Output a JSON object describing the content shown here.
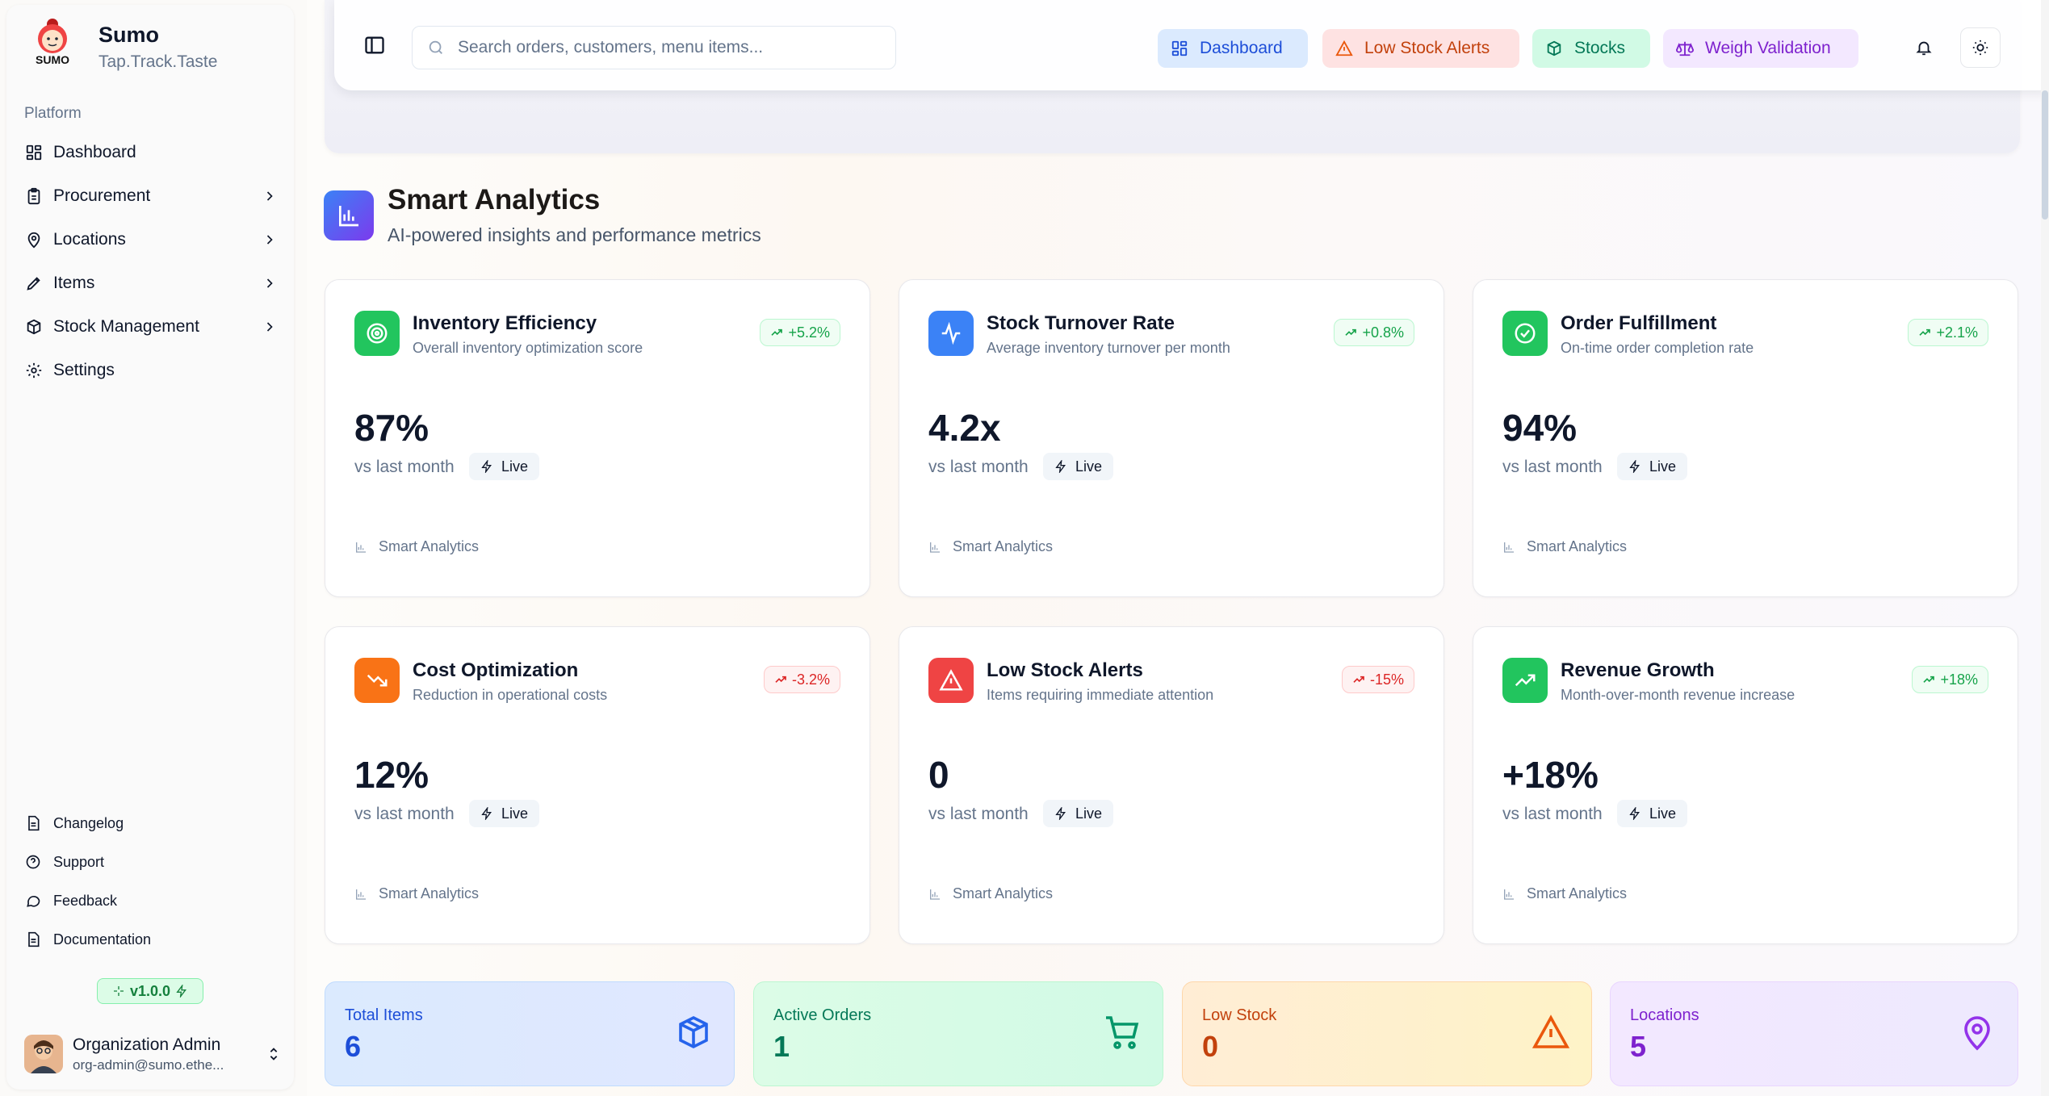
{
  "brand": {
    "title": "Sumo",
    "subtitle": "Tap.Track.Taste",
    "logo_text": "SUMO"
  },
  "sidebar": {
    "group_label": "Platform",
    "items": [
      {
        "label": "Dashboard",
        "icon": "layout-grid-icon",
        "has_submenu": false
      },
      {
        "label": "Procurement",
        "icon": "clipboard-icon",
        "has_submenu": true
      },
      {
        "label": "Locations",
        "icon": "map-pin-icon",
        "has_submenu": true
      },
      {
        "label": "Items",
        "icon": "pen-tool-icon",
        "has_submenu": true
      },
      {
        "label": "Stock Management",
        "icon": "boxes-icon",
        "has_submenu": true
      },
      {
        "label": "Settings",
        "icon": "gear-icon",
        "has_submenu": false
      }
    ],
    "footer_items": [
      {
        "label": "Changelog",
        "icon": "document-icon"
      },
      {
        "label": "Support",
        "icon": "help-circle-icon"
      },
      {
        "label": "Feedback",
        "icon": "message-circle-icon"
      },
      {
        "label": "Documentation",
        "icon": "document-icon"
      }
    ],
    "version": "v1.0.0",
    "user": {
      "name": "Organization Admin",
      "email": "org-admin@sumo.ethe..."
    }
  },
  "header": {
    "search_placeholder": "Search orders, customers, menu items...",
    "quick_links": [
      {
        "label": "Dashboard",
        "color": "#1d4ed8"
      },
      {
        "label": "Low Stock Alerts",
        "color": "#c2410c"
      },
      {
        "label": "Stocks",
        "color": "#047857"
      },
      {
        "label": "Weigh Validation",
        "color": "#7e22ce"
      }
    ]
  },
  "section": {
    "title": "Smart Analytics",
    "subtitle": "AI-powered insights and performance metrics"
  },
  "metrics": [
    {
      "title": "Inventory Efficiency",
      "description": "Overall inventory optimization score",
      "change": "+5.2%",
      "trend": "up",
      "value": "87%",
      "vs": "vs last month",
      "live": "Live",
      "footer": "Smart Analytics",
      "icon": "target-icon",
      "color": "#22c55e"
    },
    {
      "title": "Stock Turnover Rate",
      "description": "Average inventory turnover per month",
      "change": "+0.8%",
      "trend": "up",
      "value": "4.2x",
      "vs": "vs last month",
      "live": "Live",
      "footer": "Smart Analytics",
      "icon": "activity-icon",
      "color": "#3b82f6"
    },
    {
      "title": "Order Fulfillment",
      "description": "On-time order completion rate",
      "change": "+2.1%",
      "trend": "up",
      "value": "94%",
      "vs": "vs last month",
      "live": "Live",
      "footer": "Smart Analytics",
      "icon": "check-circle-icon",
      "color": "#22c55e"
    },
    {
      "title": "Cost Optimization",
      "description": "Reduction in operational costs",
      "change": "-3.2%",
      "trend": "down",
      "value": "12%",
      "vs": "vs last month",
      "live": "Live",
      "footer": "Smart Analytics",
      "icon": "trending-down-icon",
      "color": "#f97316"
    },
    {
      "title": "Low Stock Alerts",
      "description": "Items requiring immediate attention",
      "change": "-15%",
      "trend": "down",
      "value": "0",
      "vs": "vs last month",
      "live": "Live",
      "footer": "Smart Analytics",
      "icon": "alert-triangle-icon",
      "color": "#ef4444"
    },
    {
      "title": "Revenue Growth",
      "description": "Month-over-month revenue increase",
      "change": "+18%",
      "trend": "up",
      "value": "+18%",
      "vs": "vs last month",
      "live": "Live",
      "footer": "Smart Analytics",
      "icon": "trending-up-icon",
      "color": "#22c55e"
    }
  ],
  "stats": [
    {
      "label": "Total Items",
      "value": "6",
      "icon": "box-icon"
    },
    {
      "label": "Active Orders",
      "value": "1",
      "icon": "shopping-cart-icon"
    },
    {
      "label": "Low Stock",
      "value": "0",
      "icon": "alert-triangle-icon"
    },
    {
      "label": "Locations",
      "value": "5",
      "icon": "map-pin-icon"
    }
  ]
}
